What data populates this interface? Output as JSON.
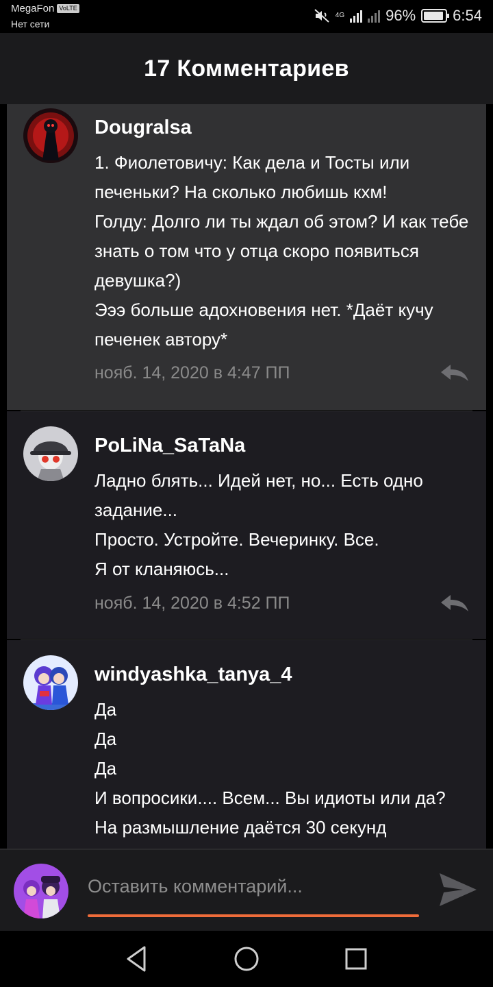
{
  "status_bar": {
    "carrier": "MegaFon",
    "volte": "VoLTE",
    "network_status": "Нет сети",
    "battery": "96%",
    "time": "6:54",
    "network_type": "4G"
  },
  "header": {
    "title": "17 Комментариев"
  },
  "comments": [
    {
      "username": "Dougralsa",
      "body": "1. Фиолетовичу: Как дела и Тосты или печеньки? На сколько любишь кхм!\nГолду: Долго ли ты ждал об этом? И как тебе знать о том что у отца скоро появиться девушка?)\nЭээ больше адохновения нет. *Даёт кучу печенек автору*",
      "timestamp": "нояб. 14, 2020 в 4:47 ПП",
      "avatar_icon": "avatar-red-dark"
    },
    {
      "username": "PoLiNa_SaTaNa",
      "body": "Ладно блять... Идей нет, но... Есть одно задание...\nПросто. Устройте. Вечеринку. Все.\nЯ от кланяюсь...",
      "timestamp": "нояб. 14, 2020 в 4:52 ПП",
      "avatar_icon": "avatar-grey-hat"
    },
    {
      "username": "windyashka_tanya_4",
      "body": "Да\nДа\nДа\nИ вопросики.... Всем... Вы идиоты или да?\nНа размышление даётся 30 секунд",
      "avatar_icon": "avatar-blue-purple"
    }
  ],
  "input_bar": {
    "placeholder": "Оставить комментарий...",
    "accent_color": "#ef6c3a"
  },
  "nav": {
    "back": "back-icon",
    "home": "home-icon",
    "recents": "recents-icon"
  }
}
